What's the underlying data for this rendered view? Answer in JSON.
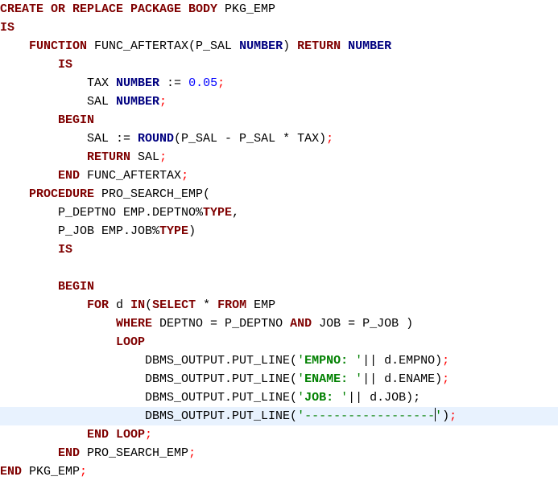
{
  "editor": {
    "current_line": 22,
    "lines": [
      [
        {
          "t": "CREATE OR REPLACE PACKAGE BODY",
          "c": "kw"
        },
        {
          "t": " PKG_EMP",
          "c": "id"
        }
      ],
      [
        {
          "t": "IS",
          "c": "kw"
        }
      ],
      [
        {
          "t": "    ",
          "c": "id"
        },
        {
          "t": "FUNCTION",
          "c": "kw"
        },
        {
          "t": " FUNC_AFTERTAX(P_SAL ",
          "c": "id"
        },
        {
          "t": "NUMBER",
          "c": "type"
        },
        {
          "t": ") ",
          "c": "id"
        },
        {
          "t": "RETURN",
          "c": "kw"
        },
        {
          "t": " ",
          "c": "id"
        },
        {
          "t": "NUMBER",
          "c": "type"
        }
      ],
      [
        {
          "t": "        ",
          "c": "id"
        },
        {
          "t": "IS",
          "c": "kw"
        }
      ],
      [
        {
          "t": "            TAX ",
          "c": "id"
        },
        {
          "t": "NUMBER",
          "c": "type"
        },
        {
          "t": " := ",
          "c": "id"
        },
        {
          "t": "0.05",
          "c": "num"
        },
        {
          "t": ";",
          "c": "punct"
        }
      ],
      [
        {
          "t": "            SAL ",
          "c": "id"
        },
        {
          "t": "NUMBER",
          "c": "type"
        },
        {
          "t": ";",
          "c": "punct"
        }
      ],
      [
        {
          "t": "        ",
          "c": "id"
        },
        {
          "t": "BEGIN",
          "c": "kw"
        }
      ],
      [
        {
          "t": "            SAL := ",
          "c": "id"
        },
        {
          "t": "ROUND",
          "c": "type"
        },
        {
          "t": "(P_SAL - P_SAL * TAX)",
          "c": "id"
        },
        {
          "t": ";",
          "c": "punct"
        }
      ],
      [
        {
          "t": "            ",
          "c": "id"
        },
        {
          "t": "RETURN",
          "c": "kw"
        },
        {
          "t": " SAL",
          "c": "id"
        },
        {
          "t": ";",
          "c": "punct"
        }
      ],
      [
        {
          "t": "        ",
          "c": "id"
        },
        {
          "t": "END",
          "c": "kw"
        },
        {
          "t": " FUNC_AFTERTAX",
          "c": "id"
        },
        {
          "t": ";",
          "c": "punct"
        }
      ],
      [
        {
          "t": "    ",
          "c": "id"
        },
        {
          "t": "PROCEDURE",
          "c": "kw"
        },
        {
          "t": " PRO_SEARCH_EMP(",
          "c": "id"
        }
      ],
      [
        {
          "t": "        P_DEPTNO EMP.DEPTNO%",
          "c": "id"
        },
        {
          "t": "TYPE",
          "c": "kw"
        },
        {
          "t": ",",
          "c": "id"
        }
      ],
      [
        {
          "t": "        P_JOB EMP.JOB%",
          "c": "id"
        },
        {
          "t": "TYPE",
          "c": "kw"
        },
        {
          "t": ")",
          "c": "id"
        }
      ],
      [
        {
          "t": "        ",
          "c": "id"
        },
        {
          "t": "IS",
          "c": "kw"
        }
      ],
      [],
      [
        {
          "t": "        ",
          "c": "id"
        },
        {
          "t": "BEGIN",
          "c": "kw"
        }
      ],
      [
        {
          "t": "            ",
          "c": "id"
        },
        {
          "t": "FOR",
          "c": "kw"
        },
        {
          "t": " d ",
          "c": "id"
        },
        {
          "t": "IN",
          "c": "kw"
        },
        {
          "t": "(",
          "c": "id"
        },
        {
          "t": "SELECT",
          "c": "kw"
        },
        {
          "t": " * ",
          "c": "id"
        },
        {
          "t": "FROM",
          "c": "kw"
        },
        {
          "t": " EMP",
          "c": "id"
        }
      ],
      [
        {
          "t": "                ",
          "c": "id"
        },
        {
          "t": "WHERE",
          "c": "kw"
        },
        {
          "t": " DEPTNO = P_DEPTNO ",
          "c": "id"
        },
        {
          "t": "AND",
          "c": "kw"
        },
        {
          "t": " JOB = P_JOB )",
          "c": "id"
        }
      ],
      [
        {
          "t": "                ",
          "c": "id"
        },
        {
          "t": "LOOP",
          "c": "kw"
        }
      ],
      [
        {
          "t": "                    DBMS_OUTPUT.PUT_LINE(",
          "c": "id"
        },
        {
          "t": "'",
          "c": "str"
        },
        {
          "t": "EMPNO:",
          "c": "strb"
        },
        {
          "t": " '",
          "c": "str"
        },
        {
          "t": "|| d.EMPNO)",
          "c": "id"
        },
        {
          "t": ";",
          "c": "punct"
        }
      ],
      [
        {
          "t": "                    DBMS_OUTPUT.PUT_LINE(",
          "c": "id"
        },
        {
          "t": "'",
          "c": "str"
        },
        {
          "t": "ENAME:",
          "c": "strb"
        },
        {
          "t": " '",
          "c": "str"
        },
        {
          "t": "|| d.ENAME)",
          "c": "id"
        },
        {
          "t": ";",
          "c": "punct"
        }
      ],
      [
        {
          "t": "                    DBMS_OUTPUT.PUT_LINE(",
          "c": "id"
        },
        {
          "t": "'",
          "c": "str"
        },
        {
          "t": "JOB:",
          "c": "strb"
        },
        {
          "t": " '",
          "c": "str"
        },
        {
          "t": "|| d.JOB)",
          "c": "id"
        },
        {
          "t": ";",
          "c": "id"
        }
      ],
      [
        {
          "t": "                    DBMS_OUTPUT.PUT_LINE(",
          "c": "id"
        },
        {
          "t": "'------------------",
          "c": "str"
        },
        {
          "caret": true
        },
        {
          "t": "'",
          "c": "str"
        },
        {
          "t": ")",
          "c": "id"
        },
        {
          "t": ";",
          "c": "punct"
        }
      ],
      [
        {
          "t": "            ",
          "c": "id"
        },
        {
          "t": "END LOOP",
          "c": "kw"
        },
        {
          "t": ";",
          "c": "punct"
        }
      ],
      [
        {
          "t": "        ",
          "c": "id"
        },
        {
          "t": "END",
          "c": "kw"
        },
        {
          "t": " PRO_SEARCH_EMP",
          "c": "id"
        },
        {
          "t": ";",
          "c": "punct"
        }
      ],
      [
        {
          "t": "END",
          "c": "kw"
        },
        {
          "t": " PKG_EMP",
          "c": "id"
        },
        {
          "t": ";",
          "c": "punct"
        }
      ]
    ]
  }
}
